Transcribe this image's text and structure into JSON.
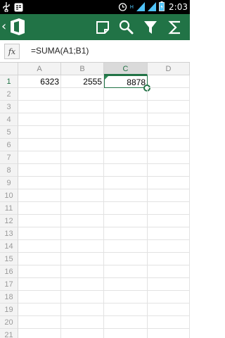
{
  "status_bar": {
    "time": "2:03",
    "network_label": "H",
    "left_icons": [
      "usb-icon",
      "bbm-icon"
    ],
    "right_icons": [
      "alarm-icon",
      "network-type-icon",
      "signal-icon",
      "signal2-icon",
      "battery-icon"
    ]
  },
  "app_bar": {
    "back_icon": "chevron-left-icon",
    "logo_icon": "office-logo-icon",
    "buttons": [
      {
        "name": "comment-button",
        "icon": "comment-icon"
      },
      {
        "name": "search-button",
        "icon": "search-icon"
      },
      {
        "name": "filter-button",
        "icon": "filter-icon"
      },
      {
        "name": "autosum-button",
        "icon": "sigma-icon"
      }
    ],
    "color": "#217346"
  },
  "formula_bar": {
    "fx_label": "fx",
    "formula": "=SUMA(A1;B1)"
  },
  "sheet": {
    "columns": [
      "A",
      "B",
      "C",
      "D"
    ],
    "rows": [
      "1",
      "2",
      "3",
      "4",
      "5",
      "6",
      "7",
      "8",
      "9",
      "10",
      "11",
      "12",
      "13",
      "14",
      "15",
      "16",
      "17",
      "18",
      "19",
      "20",
      "21"
    ],
    "selected_column": "C",
    "selected_row": "1",
    "cells": {
      "A1": "6323",
      "B1": "2555",
      "C1": "8878"
    },
    "accent_color": "#217346"
  }
}
